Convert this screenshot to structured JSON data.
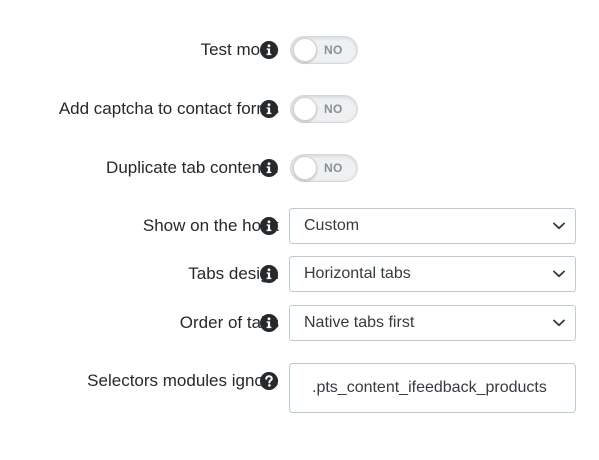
{
  "form": {
    "test_mode": {
      "label": "Test mode",
      "state": "NO",
      "icon": "info-icon"
    },
    "captcha": {
      "label": "Add captcha to contact forms",
      "state": "NO",
      "icon": "info-icon"
    },
    "duplicate_tab": {
      "label": "Duplicate tab contents.",
      "state": "NO",
      "icon": "info-icon"
    },
    "show_on_hook": {
      "label": "Show on the hook",
      "value": "Custom",
      "icon": "info-icon"
    },
    "tabs_design": {
      "label": "Tabs design",
      "value": "Horizontal tabs",
      "icon": "info-icon"
    },
    "order_of_tabs": {
      "label": "Order of tabs",
      "value": "Native tabs first",
      "icon": "info-icon"
    },
    "selectors_ignore": {
      "label": "Selectors modules ignore",
      "value": ".pts_content_ifeedback_products",
      "icon": "question-icon"
    }
  },
  "colors": {
    "icon": "#25292c",
    "border": "#bbcdd2",
    "toggle_bg": "#eef0f2",
    "toggle_text": "#8a9096"
  }
}
